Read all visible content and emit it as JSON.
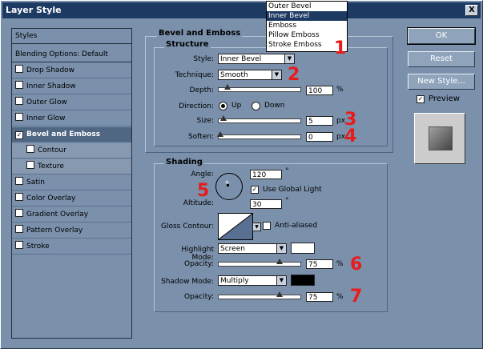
{
  "window": {
    "title": "Layer Style",
    "close_label": "X"
  },
  "styles_panel": {
    "header": "Styles",
    "blending": "Blending Options: Default",
    "items": [
      {
        "label": "Drop Shadow",
        "checked": false
      },
      {
        "label": "Inner Shadow",
        "checked": false
      },
      {
        "label": "Outer Glow",
        "checked": false
      },
      {
        "label": "Inner Glow",
        "checked": false
      },
      {
        "label": "Bevel and Emboss",
        "checked": true
      },
      {
        "label": "Contour",
        "checked": false
      },
      {
        "label": "Texture",
        "checked": false
      },
      {
        "label": "Satin",
        "checked": false
      },
      {
        "label": "Color Overlay",
        "checked": false
      },
      {
        "label": "Gradient Overlay",
        "checked": false
      },
      {
        "label": "Pattern Overlay",
        "checked": false
      },
      {
        "label": "Stroke",
        "checked": false
      }
    ]
  },
  "buttons": {
    "ok": "OK",
    "reset": "Reset",
    "new_style": "New Style...",
    "preview": "Preview"
  },
  "bevel": {
    "section": "Bevel and Emboss",
    "structure": "Structure",
    "style_label": "Style:",
    "style_value": "Inner Bevel",
    "technique_label": "Technique:",
    "technique_value": "Smooth",
    "depth_label": "Depth:",
    "depth_value": "100",
    "depth_unit": "%",
    "direction_label": "Direction:",
    "dir_up": "Up",
    "dir_down": "Down",
    "size_label": "Size:",
    "size_value": "5",
    "size_unit": "px",
    "soften_label": "Soften:",
    "soften_value": "0",
    "soften_unit": "px"
  },
  "shading": {
    "section": "Shading",
    "angle_label": "Angle:",
    "angle_value": "120",
    "angle_unit": "°",
    "global_light": "Use Global Light",
    "altitude_label": "Altitude:",
    "altitude_value": "30",
    "altitude_unit": "°",
    "gloss_label": "Gloss Contour:",
    "anti_aliased": "Anti-aliased",
    "highlight_label": "Highlight Mode:",
    "highlight_value": "Screen",
    "opacity_label": "Opacity:",
    "highlight_opacity": "75",
    "shadow_label": "Shadow Mode:",
    "shadow_value": "Multiply",
    "shadow_opacity": "75",
    "percent": "%",
    "highlight_color": "#ffffff",
    "shadow_color": "#000000"
  },
  "style_dropdown": {
    "options": [
      "Outer Bevel",
      "Inner Bevel",
      "Emboss",
      "Pillow Emboss",
      "Stroke Emboss"
    ],
    "selected": "Inner Bevel"
  },
  "annotations": [
    "1",
    "2",
    "3",
    "4",
    "5",
    "6",
    "7"
  ]
}
